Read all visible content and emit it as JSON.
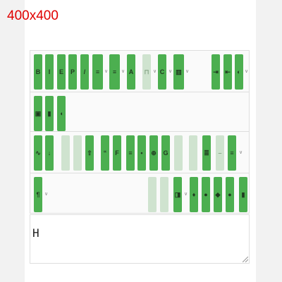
{
  "corner_label": "400x400",
  "editor": {
    "title": "",
    "content": "H"
  },
  "toolbar": {
    "row1": [
      {
        "icon": "bold-icon",
        "glyph": "B"
      },
      {
        "icon": "italic-icon",
        "glyph": "I"
      },
      {
        "icon": "text-format-icon",
        "glyph": "E"
      },
      {
        "icon": "pin-icon",
        "glyph": "P"
      },
      {
        "icon": "pen-icon",
        "glyph": "/"
      },
      {
        "icon": "list-icon",
        "glyph": "≡"
      },
      {
        "icon": "ordered-list-icon",
        "glyph": "≡"
      },
      {
        "icon": "font-size-icon",
        "glyph": "A"
      },
      {
        "icon": "align-icon",
        "glyph": "⊓"
      },
      {
        "icon": "color-icon",
        "glyph": "C"
      },
      {
        "icon": "table-icon",
        "glyph": "▥"
      },
      {
        "icon": "indent-icon",
        "glyph": "⇥"
      },
      {
        "icon": "outdent-icon",
        "glyph": "⇤"
      },
      {
        "icon": "highlight-icon",
        "glyph": "◐"
      }
    ],
    "row2": [
      {
        "icon": "image-icon",
        "glyph": "▣"
      },
      {
        "icon": "video-icon",
        "glyph": "▮"
      },
      {
        "icon": "audio-icon",
        "glyph": "◖"
      }
    ],
    "row3": [
      {
        "icon": "link-icon",
        "glyph": "∿"
      },
      {
        "icon": "unlink-icon",
        "glyph": "↓"
      },
      {
        "icon": "undo-icon",
        "glyph": ""
      },
      {
        "icon": "redo-icon",
        "glyph": ""
      },
      {
        "icon": "upload-icon",
        "glyph": "⇧"
      },
      {
        "icon": "quote-icon",
        "glyph": "“"
      },
      {
        "icon": "code-icon",
        "glyph": "F"
      },
      {
        "icon": "hr-icon",
        "glyph": "≡"
      },
      {
        "icon": "emoji-icon",
        "glyph": "•"
      },
      {
        "icon": "search-icon",
        "glyph": "⊕"
      },
      {
        "icon": "replace-icon",
        "glyph": "G"
      },
      {
        "icon": "clear-format-icon",
        "glyph": ""
      },
      {
        "icon": "subscript-icon",
        "glyph": ""
      },
      {
        "icon": "superscript-icon",
        "glyph": "≣"
      },
      {
        "icon": "strikethrough-icon",
        "glyph": "–"
      },
      {
        "icon": "underline-icon",
        "glyph": "≡"
      }
    ],
    "row4_left": [
      {
        "icon": "paragraph-icon",
        "glyph": "¶"
      }
    ],
    "row4_right": [
      {
        "icon": "preview-icon",
        "glyph": ""
      },
      {
        "icon": "print-icon",
        "glyph": ""
      },
      {
        "icon": "fullscreen-icon",
        "glyph": "◨"
      },
      {
        "icon": "source-icon",
        "glyph": "♦"
      },
      {
        "icon": "help-icon",
        "glyph": "●"
      },
      {
        "icon": "settings-icon",
        "glyph": "◆"
      },
      {
        "icon": "save-icon",
        "glyph": "●"
      },
      {
        "icon": "more-icon",
        "glyph": "▮"
      }
    ]
  },
  "colors": {
    "button_active": "#4caf50",
    "button_disabled": "#cfe3cf",
    "label_red": "#e00000"
  }
}
